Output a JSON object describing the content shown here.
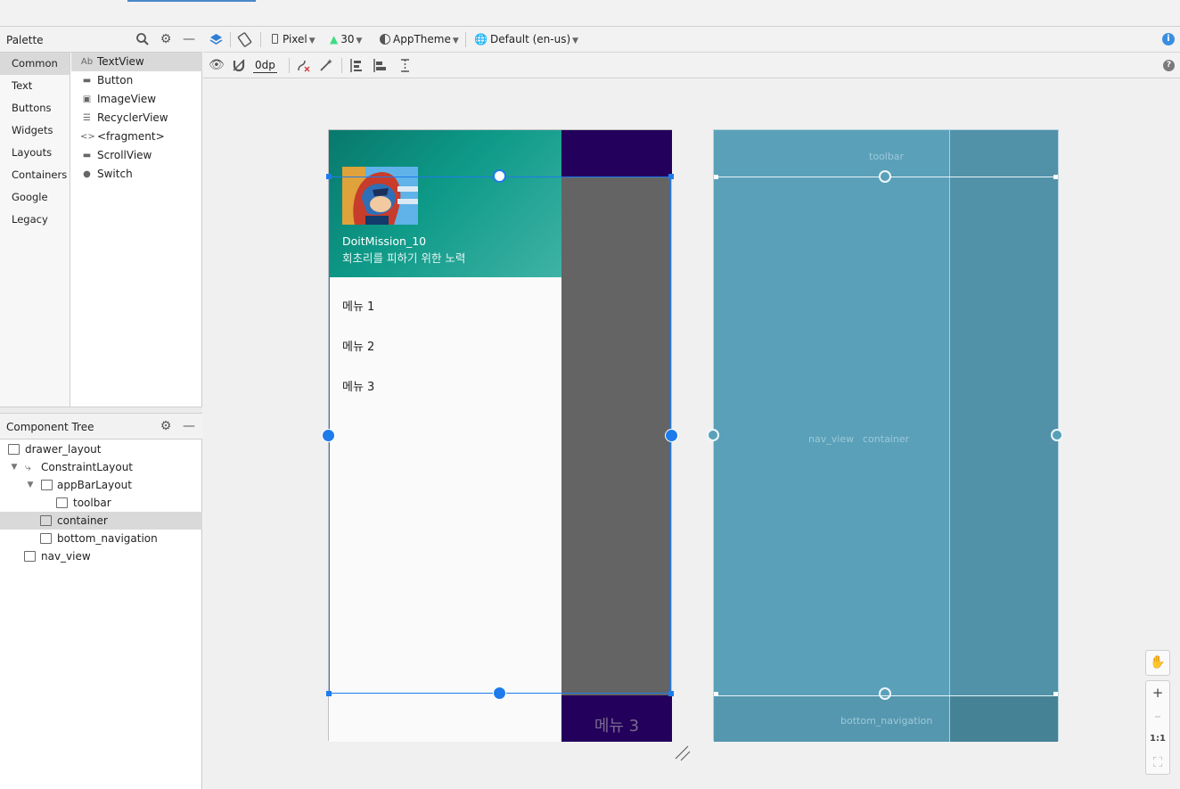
{
  "palette": {
    "title": "Palette",
    "categories": [
      "Common",
      "Text",
      "Buttons",
      "Widgets",
      "Layouts",
      "Containers",
      "Google",
      "Legacy"
    ],
    "items": [
      {
        "glyph": "Ab",
        "label": "TextView"
      },
      {
        "glyph": "▬",
        "label": "Button"
      },
      {
        "glyph": "▣",
        "label": "ImageView"
      },
      {
        "glyph": "☰",
        "label": "RecyclerView"
      },
      {
        "glyph": "<>",
        "label": "<fragment>"
      },
      {
        "glyph": "▬",
        "label": "ScrollView"
      },
      {
        "glyph": "●",
        "label": "Switch"
      }
    ]
  },
  "component_tree": {
    "title": "Component Tree",
    "nodes": [
      {
        "label": "drawer_layout"
      },
      {
        "label": "ConstraintLayout"
      },
      {
        "label": "appBarLayout"
      },
      {
        "label": "toolbar"
      },
      {
        "label": "container"
      },
      {
        "label": "bottom_navigation"
      },
      {
        "label": "nav_view"
      }
    ]
  },
  "toolbar": {
    "device": "Pixel",
    "api": "30",
    "theme": "AppTheme",
    "locale": "Default (en-us)",
    "margin": "0dp"
  },
  "design": {
    "header_title": "DoitMission_10",
    "header_subtitle": "회초리를 피하기 위한 노력",
    "menu_items": [
      "메뉴 1",
      "메뉴 2",
      "메뉴 3"
    ],
    "bottom_nav_label": "메뉴 3"
  },
  "blueprint": {
    "toolbar_label": "toolbar",
    "nav_label": "nav_view",
    "container_label": "container",
    "bottom_label": "bottom_navigation"
  },
  "zoom": {
    "pan": "✋",
    "zoom_in": "+",
    "zoom_out": "–",
    "actual_size": "1:1",
    "fit": "⛶"
  },
  "colors": {
    "accent": "#1e7bea",
    "header_teal": "#0e9a88",
    "purple": "#23005b",
    "scrim": "#646464",
    "blueprint": "#5aa0b9"
  }
}
